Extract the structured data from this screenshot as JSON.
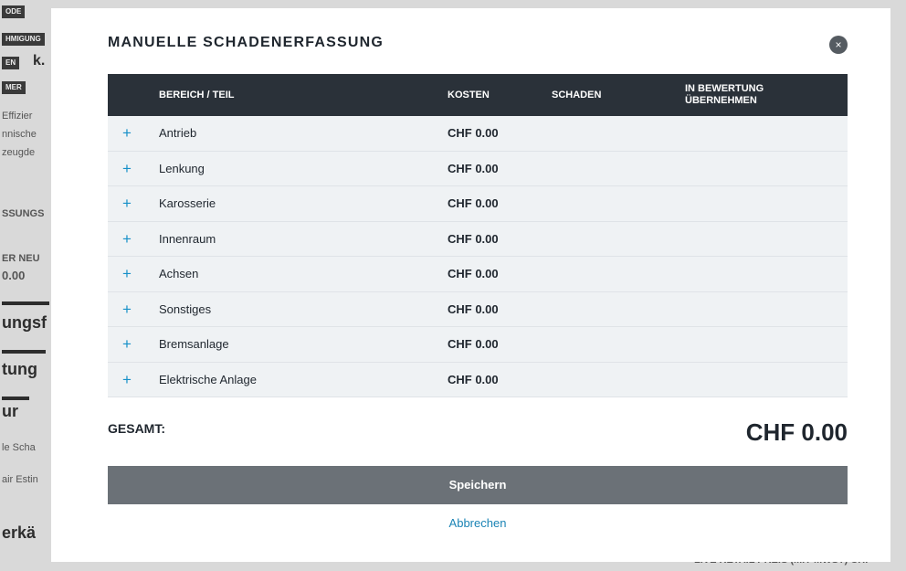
{
  "background": {
    "tags": [
      "ODE",
      "HMIGUNG",
      "EN",
      "MER"
    ],
    "fragments": [
      "k.",
      "Effizier",
      "nnische",
      "zeugde",
      "SSUNGS",
      "ER NEU",
      "0.00",
      "ungsf",
      "tung",
      "ur",
      "le Scha",
      "air Estin",
      "erkä"
    ],
    "bottom_text": "LIVE RETAIL PREIS (MIT MWST) CHF"
  },
  "modal": {
    "title": "MANUELLE SCHADENERFASSUNG",
    "close_icon": "×",
    "columns": {
      "part": "BEREICH / TEIL",
      "cost": "KOSTEN",
      "damage": "SCHADEN",
      "adopt": "IN BEWERTUNG ÜBERNEHMEN"
    },
    "rows": [
      {
        "name": "Antrieb",
        "cost": "CHF 0.00"
      },
      {
        "name": "Lenkung",
        "cost": "CHF 0.00"
      },
      {
        "name": "Karosserie",
        "cost": "CHF 0.00"
      },
      {
        "name": "Innenraum",
        "cost": "CHF 0.00"
      },
      {
        "name": "Achsen",
        "cost": "CHF 0.00"
      },
      {
        "name": "Sonstiges",
        "cost": "CHF 0.00"
      },
      {
        "name": "Bremsanlage",
        "cost": "CHF 0.00"
      },
      {
        "name": "Elektrische Anlage",
        "cost": "CHF 0.00"
      }
    ],
    "expand_symbol": "+",
    "total_label": "GESAMT:",
    "total_value": "CHF 0.00",
    "save_label": "Speichern",
    "cancel_label": "Abbrechen"
  }
}
